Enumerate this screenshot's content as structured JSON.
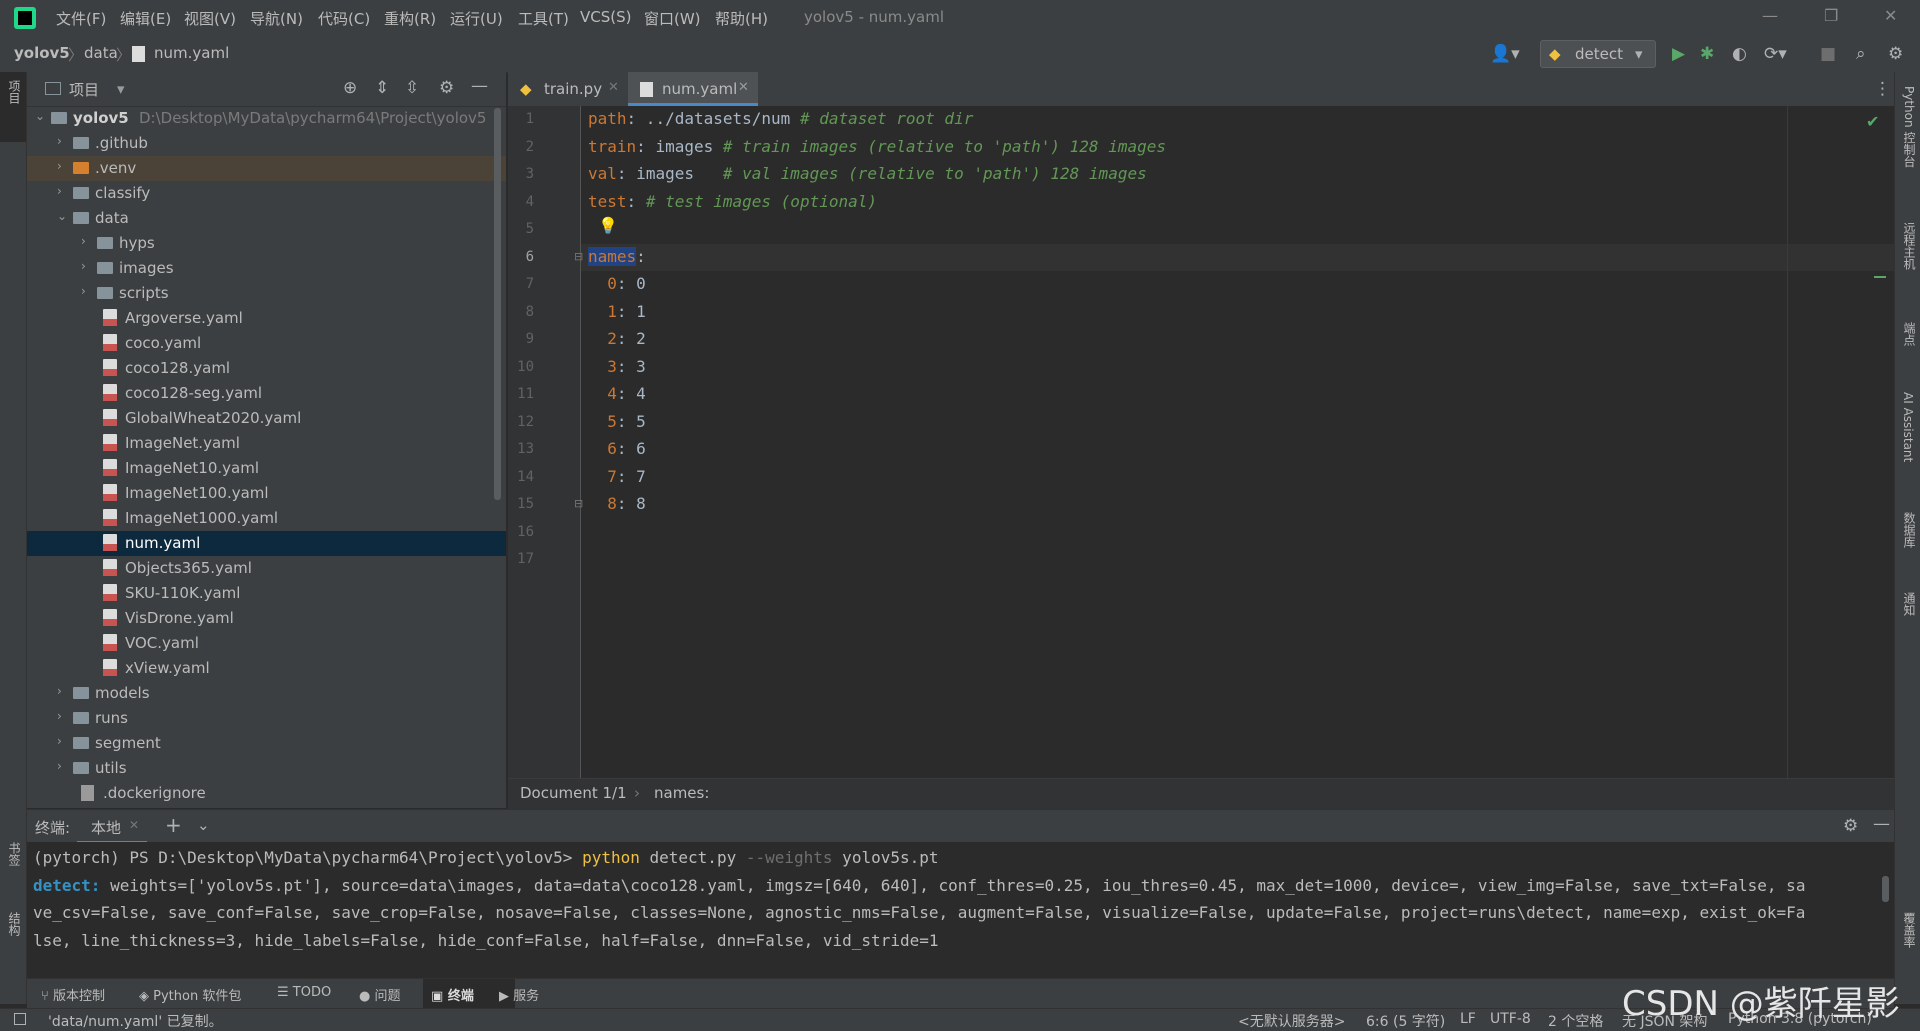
{
  "menubar": {
    "items": [
      "文件(F)",
      "编辑(E)",
      "视图(V)",
      "导航(N)",
      "代码(C)",
      "重构(R)",
      "运行(U)",
      "工具(T)",
      "VCS(S)",
      "窗口(W)",
      "帮助(H)"
    ],
    "window_title": "yolov5 - num.yaml",
    "win_min": "—",
    "win_restore": "❐",
    "win_close": "✕"
  },
  "navbar": {
    "crumbs": [
      "yolov5",
      "data",
      "num.yaml"
    ],
    "separator": "〉",
    "run_config": "detect"
  },
  "left_stripe": {
    "project_label": "项目",
    "bookmarks_label": "书签",
    "structure_label": "结构"
  },
  "right_stripe": {
    "labels": [
      "Python 控制台",
      "远程主机",
      "端点",
      "AI Assistant",
      "数据库",
      "通知",
      "覆盖率"
    ]
  },
  "project": {
    "title": "项目",
    "tree": [
      {
        "label": "yolov5",
        "path": "D:\\Desktop\\MyData\\pycharm64\\Project\\yolov5",
        "type": "root"
      },
      {
        "label": ".github",
        "type": "folder"
      },
      {
        "label": ".venv",
        "type": "folder"
      },
      {
        "label": "classify",
        "type": "folder"
      },
      {
        "label": "data",
        "type": "folder"
      },
      {
        "label": "hyps",
        "type": "folder"
      },
      {
        "label": "images",
        "type": "folder"
      },
      {
        "label": "scripts",
        "type": "folder"
      },
      {
        "label": "Argoverse.yaml",
        "type": "yaml"
      },
      {
        "label": "coco.yaml",
        "type": "yaml"
      },
      {
        "label": "coco128.yaml",
        "type": "yaml"
      },
      {
        "label": "coco128-seg.yaml",
        "type": "yaml"
      },
      {
        "label": "GlobalWheat2020.yaml",
        "type": "yaml"
      },
      {
        "label": "ImageNet.yaml",
        "type": "yaml"
      },
      {
        "label": "ImageNet10.yaml",
        "type": "yaml"
      },
      {
        "label": "ImageNet100.yaml",
        "type": "yaml"
      },
      {
        "label": "ImageNet1000.yaml",
        "type": "yaml"
      },
      {
        "label": "num.yaml",
        "type": "yaml"
      },
      {
        "label": "Objects365.yaml",
        "type": "yaml"
      },
      {
        "label": "SKU-110K.yaml",
        "type": "yaml"
      },
      {
        "label": "VisDrone.yaml",
        "type": "yaml"
      },
      {
        "label": "VOC.yaml",
        "type": "yaml"
      },
      {
        "label": "xView.yaml",
        "type": "yaml"
      },
      {
        "label": "models",
        "type": "folder"
      },
      {
        "label": "runs",
        "type": "folder"
      },
      {
        "label": "segment",
        "type": "folder"
      },
      {
        "label": "utils",
        "type": "folder"
      },
      {
        "label": ".dockerignore",
        "type": "file"
      }
    ]
  },
  "editor": {
    "tabs": [
      "train.py",
      "num.yaml"
    ],
    "active_tab": "num.yaml",
    "line_numbers": [
      "1",
      "2",
      "3",
      "4",
      "5",
      "6",
      "7",
      "8",
      "9",
      "10",
      "11",
      "12",
      "13",
      "14",
      "15",
      "16",
      "17"
    ],
    "lines": {
      "l1": {
        "key": "path",
        "value": " ../datasets/num ",
        "comment": "# dataset root dir"
      },
      "l2": {
        "key": "train",
        "value": " images ",
        "comment": "# train images (relative to 'path') 128 images"
      },
      "l3": {
        "key": "val",
        "value": " images   ",
        "comment": "# val images (relative to 'path') 128 images"
      },
      "l4": {
        "key": "test",
        "value": " ",
        "comment": "# test images (optional)"
      },
      "l6": {
        "key": "names"
      },
      "names": [
        {
          "k": "0",
          "v": "0"
        },
        {
          "k": "1",
          "v": "1"
        },
        {
          "k": "2",
          "v": "2"
        },
        {
          "k": "3",
          "v": "3"
        },
        {
          "k": "4",
          "v": "4"
        },
        {
          "k": "5",
          "v": "5"
        },
        {
          "k": "6",
          "v": "6"
        },
        {
          "k": "7",
          "v": "7"
        },
        {
          "k": "8",
          "v": "8"
        }
      ]
    },
    "breadcrumb": {
      "document": "Document 1/1",
      "node": "names:"
    }
  },
  "terminal": {
    "label": "终端:",
    "tab": "本地",
    "prompt": "(pytorch) PS D:\\Desktop\\MyData\\pycharm64\\Project\\yolov5> ",
    "cmd": "python",
    "cmd_rest": " detect.py ",
    "flag": "--weights",
    "flag_val": " yolov5s.pt",
    "out_label": "detect:",
    "out1": " weights=['yolov5s.pt'], source=data\\images, data=data\\coco128.yaml, imgsz=[640, 640], conf_thres=0.25, iou_thres=0.45, max_det=1000, device=, view_img=False, save_txt=False, sa",
    "out2": "ve_csv=False, save_conf=False, save_crop=False, nosave=False, classes=None, agnostic_nms=False, augment=False, visualize=False, update=False, project=runs\\detect, name=exp, exist_ok=Fa",
    "out3": "lse, line_thickness=3, hide_labels=False, hide_conf=False, half=False, dnn=False, vid_stride=1"
  },
  "toolbar": {
    "items": [
      "版本控制",
      "Python 软件包",
      "TODO",
      "问题",
      "终端",
      "服务"
    ]
  },
  "statusbar": {
    "message": "'data/num.yaml' 已复制。",
    "server": "<无默认服务器>",
    "position": "6:6 (5 字符)",
    "line_sep": "LF",
    "encoding": "UTF-8",
    "indent": "2 个空格",
    "schema": "无 JSON 架构",
    "interpreter": "Python 3.8 (pytorch)"
  },
  "watermark": "CSDN @紫阡星影"
}
